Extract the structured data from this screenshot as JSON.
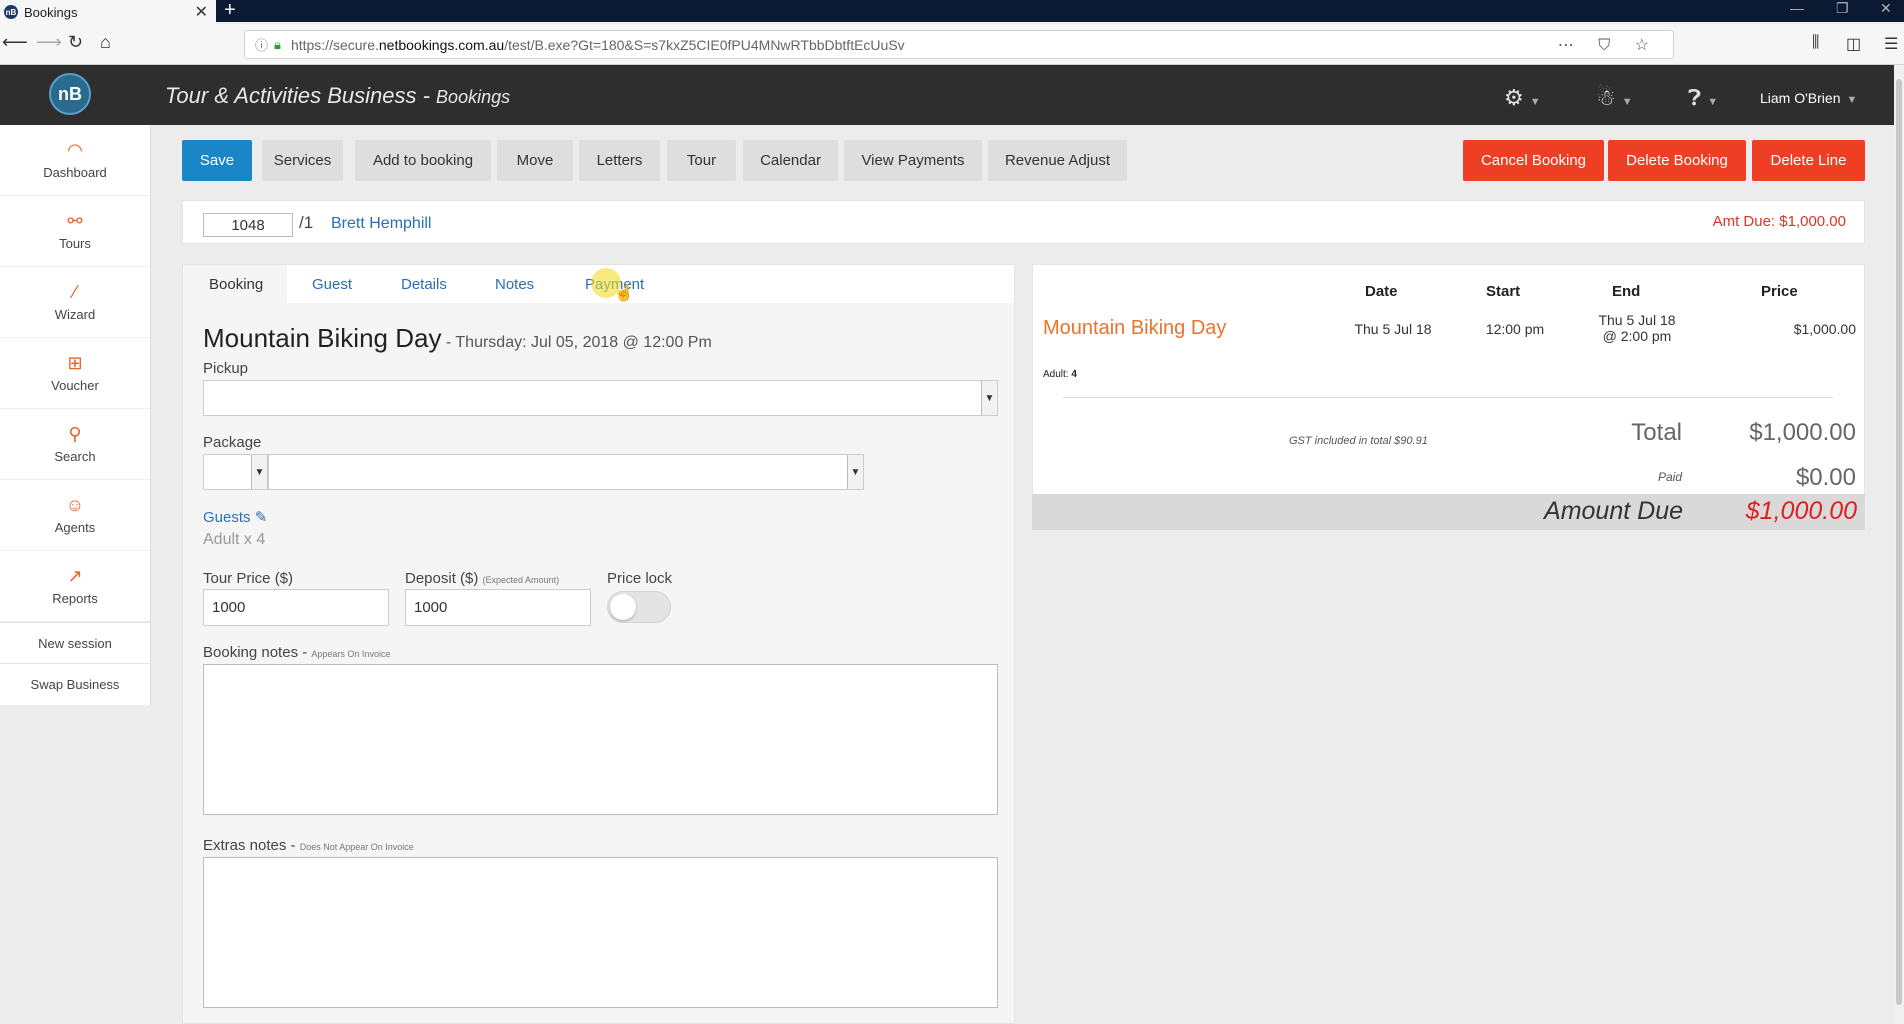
{
  "browser": {
    "tab_title": "Bookings",
    "tab_close": "✕",
    "new_tab": "+",
    "url_prefix": "https://secure.",
    "url_host": "netbookings.com.au",
    "url_path": "/test/B.exe?Gt=180&S=s7kxZ5CIE0fPU4MNwRTbbDbtftEcUuSv"
  },
  "header": {
    "logo_text": "nB",
    "business_name": "Tour & Activities Business",
    "separator": " - ",
    "page_name": "Bookings",
    "user_name": "Liam O'Brien"
  },
  "sidebar": {
    "items": [
      {
        "label": "Dashboard",
        "icon": "dashboard-icon"
      },
      {
        "label": "Tours",
        "icon": "tours-icon"
      },
      {
        "label": "Wizard",
        "icon": "wizard-icon"
      },
      {
        "label": "Voucher",
        "icon": "voucher-icon"
      },
      {
        "label": "Search",
        "icon": "search-icon"
      },
      {
        "label": "Agents",
        "icon": "agents-icon"
      },
      {
        "label": "Reports",
        "icon": "reports-icon"
      }
    ],
    "links": [
      "New session",
      "Swap Business"
    ]
  },
  "toolbar": {
    "save": "Save",
    "services": "Services",
    "add_to_booking": "Add to booking",
    "move": "Move",
    "letters": "Letters",
    "tour": "Tour",
    "calendar": "Calendar",
    "view_payments": "View Payments",
    "revenue_adjust": "Revenue Adjust",
    "cancel_booking": "Cancel Booking",
    "delete_booking": "Delete Booking",
    "delete_line": "Delete Line"
  },
  "booking": {
    "ref": "1048",
    "ref_suffix": "/1",
    "customer": "Brett Hemphill",
    "amt_due": "Amt Due: $1,000.00"
  },
  "tabs": [
    "Booking",
    "Guest",
    "Details",
    "Notes",
    "Payment"
  ],
  "form": {
    "service_title": "Mountain Biking Day",
    "service_date": " - Thursday: Jul 05, 2018 @ 12:00 Pm",
    "pickup_label": "Pickup",
    "package_label": "Package",
    "guests_label": "Guests",
    "guests_value": "Adult x 4",
    "tour_price_label": "Tour Price ($)",
    "tour_price_value": "1000",
    "deposit_label": "Deposit ($)",
    "deposit_note": "(Expected Amount)",
    "deposit_value": "1000",
    "price_lock_label": "Price lock",
    "price_lock_on": false,
    "booking_notes_label": "Booking notes - ",
    "booking_notes_note": "Appears On Invoice",
    "extras_notes_label": "Extras notes - ",
    "extras_notes_note": "Does Not Appear On Invoice"
  },
  "summary": {
    "headers": {
      "date": "Date",
      "start": "Start",
      "end": "End",
      "price": "Price"
    },
    "row": {
      "service": "Mountain Biking Day",
      "date": "Thu 5 Jul 18",
      "start": "12:00 pm",
      "end_line1": "Thu 5 Jul 18",
      "end_line2": "@ 2:00 pm",
      "price": "$1,000.00"
    },
    "pax_label": "Adult: ",
    "pax_value": "4",
    "gst_note": "GST included in total $90.91",
    "total_label": "Total",
    "total_value": "$1,000.00",
    "paid_label": "Paid",
    "paid_value": "$0.00",
    "due_label": "Amount Due",
    "due_value": "$1,000.00"
  },
  "colors": {
    "accent_blue": "#1a86c8",
    "danger_red": "#ee3f24",
    "link_blue": "#2a6fb6",
    "service_orange": "#e8742d",
    "header_dark": "#2e2e2e"
  }
}
